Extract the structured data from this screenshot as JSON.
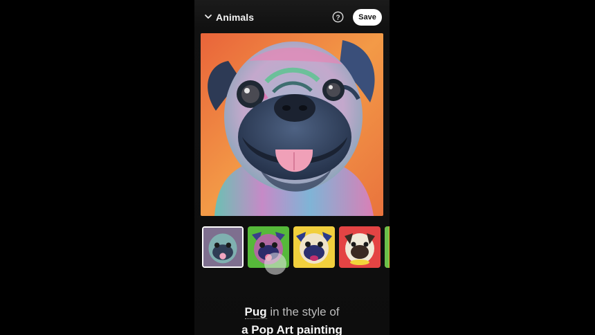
{
  "header": {
    "category": "Animals",
    "save_label": "Save",
    "collapse_icon": "chevron-down-icon",
    "help_icon": "question-circle-icon"
  },
  "main_image": {
    "alt": "Pug in the style of a Pop Art painting"
  },
  "thumbnails": [
    {
      "id": 1,
      "selected": true,
      "bg": "#7b6a8f"
    },
    {
      "id": 2,
      "selected": false,
      "bg": "#5fbf3a"
    },
    {
      "id": 3,
      "selected": false,
      "bg": "#f0d040"
    },
    {
      "id": 4,
      "selected": false,
      "bg": "#e84545"
    },
    {
      "id": 5,
      "selected": false,
      "bg": "#f0c030"
    }
  ],
  "prompt": {
    "subject": "Pug",
    "connector": " in the style of",
    "style": "a Pop Art painting"
  },
  "colors": {
    "background": "#000000",
    "accent_orange": "#f08a3a",
    "save_bg": "#ffffff"
  }
}
